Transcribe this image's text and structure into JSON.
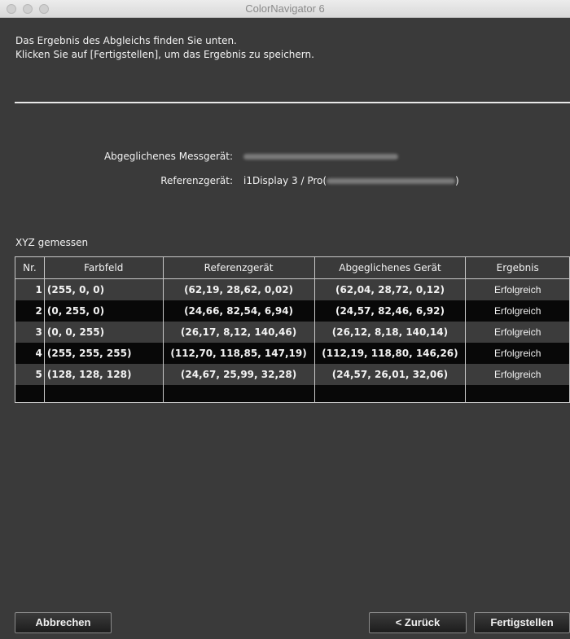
{
  "window": {
    "title": "ColorNavigator 6"
  },
  "intro": {
    "line1": "Das Ergebnis des Abgleichs finden Sie unten.",
    "line2": "Klicken Sie auf [Fertigstellen], um das Ergebnis zu speichern."
  },
  "info": {
    "matched_label": "Abgeglichenes Messgerät:",
    "reference_label": "Referenzgerät:",
    "reference_value": "i1Display 3 / Pro(",
    "reference_suffix": ")"
  },
  "section_title": "XYZ gemessen",
  "table": {
    "headers": [
      "Nr.",
      "Farbfeld",
      "Referenzgerät",
      "Abgeglichenes Gerät",
      "Ergebnis"
    ],
    "rows": [
      [
        "1",
        "(255, 0, 0)",
        "(62,19, 28,62, 0,02)",
        "(62,04, 28,72, 0,12)",
        "Erfolgreich"
      ],
      [
        "2",
        "(0, 255, 0)",
        "(24,66, 82,54, 6,94)",
        "(24,57, 82,46, 6,92)",
        "Erfolgreich"
      ],
      [
        "3",
        "(0, 0, 255)",
        "(26,17, 8,12, 140,46)",
        "(26,12, 8,18, 140,14)",
        "Erfolgreich"
      ],
      [
        "4",
        "(255, 255, 255)",
        "(112,70, 118,85, 147,19)",
        "(112,19, 118,80, 146,26)",
        "Erfolgreich"
      ],
      [
        "5",
        "(128, 128, 128)",
        "(24,67, 25,99, 32,28)",
        "(24,57, 26,01, 32,06)",
        "Erfolgreich"
      ]
    ]
  },
  "buttons": {
    "cancel": "Abbrechen",
    "back": "< Zurück",
    "finish": "Fertigstellen"
  }
}
